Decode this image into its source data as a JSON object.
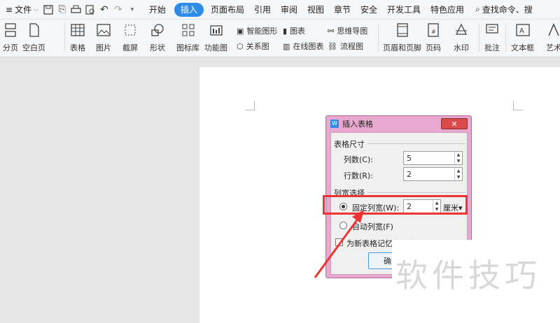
{
  "menubar": {
    "file_label": "文件",
    "tabs": [
      "开始",
      "插入",
      "页面布局",
      "引用",
      "审阅",
      "视图",
      "章节",
      "安全",
      "开发工具",
      "特色应用"
    ],
    "active_tab": "插入",
    "search_label": "查找命令、搜"
  },
  "ribbon": {
    "page_break": "分页",
    "blank_page": "空白页",
    "table": "表格",
    "picture": "图片",
    "screenshot": "截屏",
    "shape": "形状",
    "icon_lib": "图标库",
    "func_chart": "功能图",
    "smart_shape": "智能图形",
    "chart": "图表",
    "mind_map": "思维导图",
    "relation_chart": "关系图",
    "online_chart": "在线图表",
    "flow_chart": "流程图",
    "header_footer": "页眉和页脚",
    "page_number": "页码",
    "watermark": "水印",
    "annotation": "批注",
    "textbox": "文本框",
    "art_text": "艺术"
  },
  "dialog": {
    "title": "插入表格",
    "close": "✕",
    "section_size": "表格尺寸",
    "cols_label": "列数(C):",
    "cols_value": "5",
    "rows_label": "行数(R):",
    "rows_value": "2",
    "section_width": "列宽选择",
    "fixed_label": "固定列宽(W):",
    "fixed_value": "2",
    "unit": "厘米▾",
    "auto_label": "自动列宽(F)",
    "remember_label": "为新表格记忆此尺寸(S)",
    "ok_label": "确定"
  },
  "watermark_text": "软件技巧",
  "colors": {
    "accent": "#2f8be8",
    "highlight": "#ee3333",
    "dialog_frame": "#e8a8cf"
  }
}
